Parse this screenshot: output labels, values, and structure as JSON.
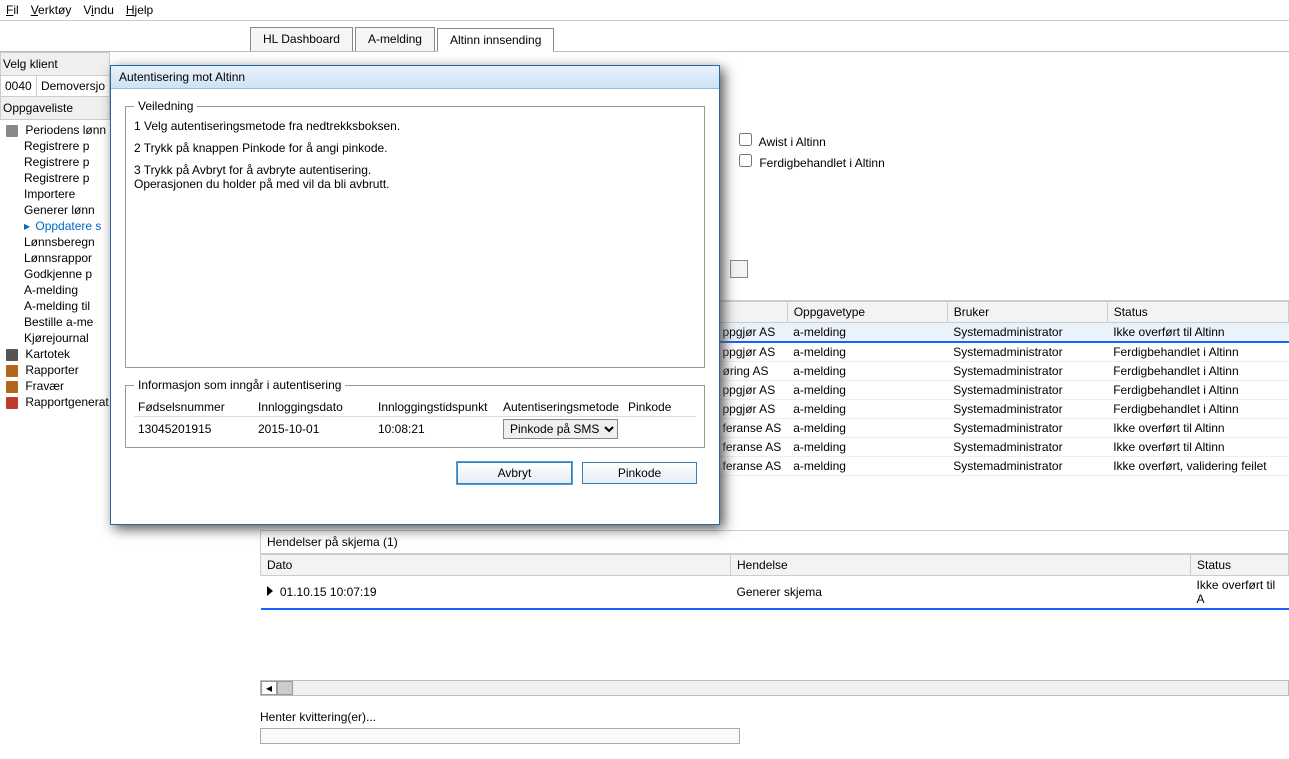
{
  "menubar": {
    "items": [
      "Fil",
      "Verktøy",
      "Vindu",
      "Hjelp"
    ]
  },
  "tabs": {
    "items": [
      {
        "label": "HL Dashboard",
        "active": false
      },
      {
        "label": "A-melding",
        "active": false
      },
      {
        "label": "Altinn innsending",
        "active": true
      }
    ]
  },
  "client_selector": {
    "label": "Velg klient",
    "code": "0040",
    "name": "Demoversjo"
  },
  "task_list": {
    "label": "Oppgaveliste",
    "sections": [
      {
        "label": "Periodens lønn",
        "children": [
          "Registrere p",
          "Registrere p",
          "Registrere p",
          "Importere",
          "Generer lønn",
          "Oppdatere s",
          "Lønnsberegn",
          "Lønnsrappor",
          "Godkjenne p",
          "A-melding",
          "A-melding til",
          "Bestille a-me",
          "Kjørejournal"
        ],
        "selected_index": 5
      },
      {
        "label": "Kartotek",
        "icon": "doc"
      },
      {
        "label": "Rapporter",
        "icon": "cal"
      },
      {
        "label": "Fravær",
        "icon": "cal"
      },
      {
        "label": "Rapportgenerat",
        "icon": "bar"
      }
    ]
  },
  "filters": {
    "avvist_label": "Awist i Altinn",
    "ferdig_label": "Ferdigbehandlet i Altinn"
  },
  "main_table": {
    "headers": {
      "client": "",
      "type": "Oppgavetype",
      "user": "Bruker",
      "status": "Status"
    },
    "rows": [
      {
        "client": "ppgjør AS",
        "type": "a-melding",
        "user": "Systemadministrator",
        "status": "Ikke overført til Altinn",
        "selected": true
      },
      {
        "client": "ppgjør AS",
        "type": "a-melding",
        "user": "Systemadministrator",
        "status": "Ferdigbehandlet i Altinn"
      },
      {
        "client": "øring AS",
        "type": "a-melding",
        "user": "Systemadministrator",
        "status": "Ferdigbehandlet i Altinn"
      },
      {
        "client": "ppgjør AS",
        "type": "a-melding",
        "user": "Systemadministrator",
        "status": "Ferdigbehandlet i Altinn"
      },
      {
        "client": "ppgjør AS",
        "type": "a-melding",
        "user": "Systemadministrator",
        "status": "Ferdigbehandlet i Altinn"
      },
      {
        "client": "feranse AS",
        "type": "a-melding",
        "user": "Systemadministrator",
        "status": "Ikke overført til Altinn"
      },
      {
        "client": "feranse AS",
        "type": "a-melding",
        "user": "Systemadministrator",
        "status": "Ikke overført til Altinn"
      },
      {
        "client": "feranse AS",
        "type": "a-melding",
        "user": "Systemadministrator",
        "status": "Ikke overført, validering feilet"
      }
    ]
  },
  "events": {
    "title": "Hendelser på skjema (1)",
    "headers": {
      "date": "Dato",
      "event": "Hendelse",
      "status": "Status"
    },
    "rows": [
      {
        "date": "01.10.15 10:07:19",
        "event": "Generer skjema",
        "status": "Ikke overført til A"
      }
    ]
  },
  "progress": {
    "label": "Henter kvittering(er)..."
  },
  "dialog": {
    "title": "Autentisering mot Altinn",
    "guide_legend": "Veiledning",
    "guide_lines": [
      "1 Velg autentiseringsmetode fra nedtrekksboksen.",
      "2 Trykk på knappen Pinkode for å angi pinkode.",
      "3 Trykk på Avbryt for å avbryte autentisering.",
      "Operasjonen du holder på med vil da bli avbrutt."
    ],
    "info_legend": "Informasjon som inngår i autentisering",
    "info_headers": {
      "fnr": "Fødselsnummer",
      "date": "Innloggingsdato",
      "time": "Innloggingstidspunkt",
      "method": "Autentiseringsmetode",
      "pin": "Pinkode"
    },
    "info_values": {
      "fnr": "13045201915",
      "date": "2015-10-01",
      "time": "10:08:21",
      "method": "Pinkode på SMS",
      "pin": ""
    },
    "buttons": {
      "cancel": "Avbryt",
      "pinkode": "Pinkode"
    }
  }
}
